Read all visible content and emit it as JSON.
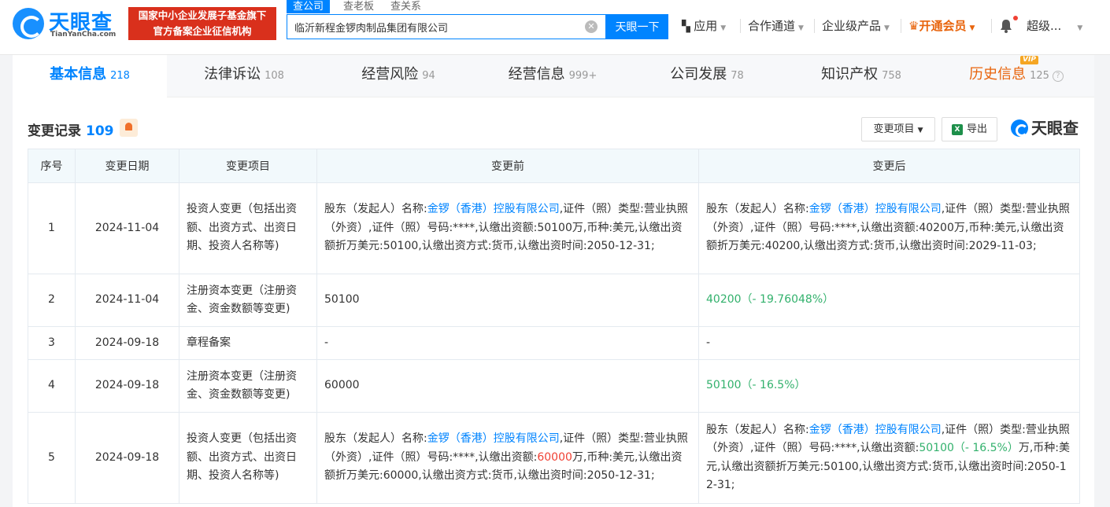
{
  "header": {
    "logo_text": "天眼查",
    "logo_sub": "TianYanCha.com",
    "banner_line1": "国家中小企业发展子基金旗下",
    "banner_line2": "官方备案企业征信机构",
    "search_tabs": [
      "查公司",
      "查老板",
      "查关系"
    ],
    "search_value": "临沂新程金锣肉制品集团有限公司",
    "search_button": "天眼一下",
    "nav": {
      "app": "应用",
      "channel": "合作通道",
      "enterprise": "企业级产品",
      "vip": "开通会员",
      "user": "超级..."
    }
  },
  "tabs": [
    {
      "label": "基本信息",
      "count": "218"
    },
    {
      "label": "法律诉讼",
      "count": "108"
    },
    {
      "label": "经营风险",
      "count": "94"
    },
    {
      "label": "经营信息",
      "count": "999+"
    },
    {
      "label": "公司发展",
      "count": "78"
    },
    {
      "label": "知识产权",
      "count": "758"
    },
    {
      "label": "历史信息",
      "count": "125"
    }
  ],
  "vip_badge": "VIP",
  "section": {
    "title": "变更记录",
    "count": "109",
    "filter_label": "变更项目",
    "export_label": "导出",
    "watermark": "天眼查"
  },
  "table": {
    "headers": [
      "序号",
      "变更日期",
      "变更项目",
      "变更前",
      "变更后"
    ],
    "rows": [
      {
        "no": "1",
        "date": "2024-11-04",
        "item": "投资人变更（包括出资额、出资方式、出资日期、投资人名称等)",
        "before": {
          "p1": "股东（发起人）名称:",
          "link": "金锣（香港）控股有限公司",
          "p2": ",证件（照）类型:营业执照（外资）,证件（照）号码:****,认缴出资额:50100万,币种:美元,认缴出资额折万美元:50100,认缴出资方式:货币,认缴出资时间:2050-12-31;"
        },
        "after": {
          "p1": "股东（发起人）名称:",
          "link": "金锣（香港）控股有限公司",
          "p2": ",证件（照）类型:营业执照（外资）,证件（照）号码:****,认缴出资额:40200万,币种:美元,认缴出资额折万美元:40200,认缴出资方式:货币,认缴出资时间:2029-11-03;"
        }
      },
      {
        "no": "2",
        "date": "2024-11-04",
        "item": "注册资本变更（注册资金、资金数额等变更)",
        "before": "50100",
        "after": "40200（- 19.76048%）"
      },
      {
        "no": "3",
        "date": "2024-09-18",
        "item": "章程备案",
        "before": "-",
        "after": "-"
      },
      {
        "no": "4",
        "date": "2024-09-18",
        "item": "注册资本变更（注册资金、资金数额等变更)",
        "before": "60000",
        "after": "50100（- 16.5%）"
      },
      {
        "no": "5",
        "date": "2024-09-18",
        "item": "投资人变更（包括出资额、出资方式、出资日期、投资人名称等)",
        "before": {
          "p1": "股东（发起人）名称:",
          "link": "金锣（香港）控股有限公司",
          "p2": ",证件（照）类型:营业执照（外资）,证件（照）号码:****,认缴出资额:",
          "red": "60000",
          "p3": "万,币种:美元,认缴出资额折万美元:60000,认缴出资方式:货币,认缴出资时间:2050-12-31;"
        },
        "after": {
          "p1": "股东（发起人）名称:",
          "link": "金锣（香港）控股有限公司",
          "p2": ",证件（照）类型:营业执照（外资）,证件（照）号码:****,认缴出资额:",
          "green": "50100（- 16.5%）",
          "p3": "万,币种:美元,认缴出资额折万美元:50100,认缴出资方式:货币,认缴出资时间:2050-12-31;"
        }
      }
    ]
  }
}
